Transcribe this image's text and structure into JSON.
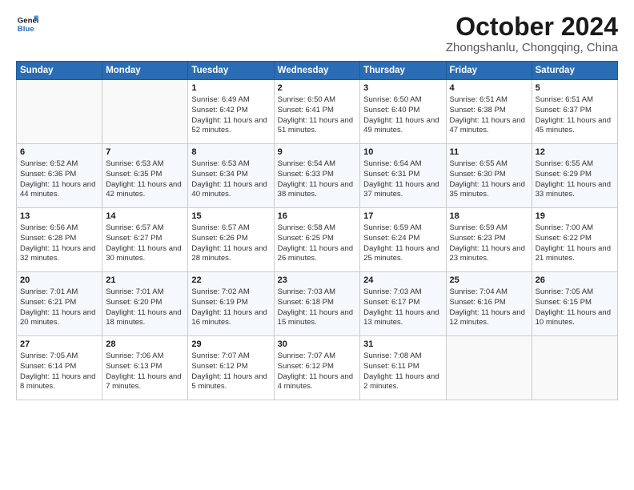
{
  "logo": {
    "line1": "General",
    "line2": "Blue"
  },
  "title": "October 2024",
  "location": "Zhongshanlu, Chongqing, China",
  "headers": [
    "Sunday",
    "Monday",
    "Tuesday",
    "Wednesday",
    "Thursday",
    "Friday",
    "Saturday"
  ],
  "weeks": [
    [
      {
        "day": "",
        "info": ""
      },
      {
        "day": "",
        "info": ""
      },
      {
        "day": "1",
        "info": "Sunrise: 6:49 AM\nSunset: 6:42 PM\nDaylight: 11 hours and 52 minutes."
      },
      {
        "day": "2",
        "info": "Sunrise: 6:50 AM\nSunset: 6:41 PM\nDaylight: 11 hours and 51 minutes."
      },
      {
        "day": "3",
        "info": "Sunrise: 6:50 AM\nSunset: 6:40 PM\nDaylight: 11 hours and 49 minutes."
      },
      {
        "day": "4",
        "info": "Sunrise: 6:51 AM\nSunset: 6:38 PM\nDaylight: 11 hours and 47 minutes."
      },
      {
        "day": "5",
        "info": "Sunrise: 6:51 AM\nSunset: 6:37 PM\nDaylight: 11 hours and 45 minutes."
      }
    ],
    [
      {
        "day": "6",
        "info": "Sunrise: 6:52 AM\nSunset: 6:36 PM\nDaylight: 11 hours and 44 minutes."
      },
      {
        "day": "7",
        "info": "Sunrise: 6:53 AM\nSunset: 6:35 PM\nDaylight: 11 hours and 42 minutes."
      },
      {
        "day": "8",
        "info": "Sunrise: 6:53 AM\nSunset: 6:34 PM\nDaylight: 11 hours and 40 minutes."
      },
      {
        "day": "9",
        "info": "Sunrise: 6:54 AM\nSunset: 6:33 PM\nDaylight: 11 hours and 38 minutes."
      },
      {
        "day": "10",
        "info": "Sunrise: 6:54 AM\nSunset: 6:31 PM\nDaylight: 11 hours and 37 minutes."
      },
      {
        "day": "11",
        "info": "Sunrise: 6:55 AM\nSunset: 6:30 PM\nDaylight: 11 hours and 35 minutes."
      },
      {
        "day": "12",
        "info": "Sunrise: 6:55 AM\nSunset: 6:29 PM\nDaylight: 11 hours and 33 minutes."
      }
    ],
    [
      {
        "day": "13",
        "info": "Sunrise: 6:56 AM\nSunset: 6:28 PM\nDaylight: 11 hours and 32 minutes."
      },
      {
        "day": "14",
        "info": "Sunrise: 6:57 AM\nSunset: 6:27 PM\nDaylight: 11 hours and 30 minutes."
      },
      {
        "day": "15",
        "info": "Sunrise: 6:57 AM\nSunset: 6:26 PM\nDaylight: 11 hours and 28 minutes."
      },
      {
        "day": "16",
        "info": "Sunrise: 6:58 AM\nSunset: 6:25 PM\nDaylight: 11 hours and 26 minutes."
      },
      {
        "day": "17",
        "info": "Sunrise: 6:59 AM\nSunset: 6:24 PM\nDaylight: 11 hours and 25 minutes."
      },
      {
        "day": "18",
        "info": "Sunrise: 6:59 AM\nSunset: 6:23 PM\nDaylight: 11 hours and 23 minutes."
      },
      {
        "day": "19",
        "info": "Sunrise: 7:00 AM\nSunset: 6:22 PM\nDaylight: 11 hours and 21 minutes."
      }
    ],
    [
      {
        "day": "20",
        "info": "Sunrise: 7:01 AM\nSunset: 6:21 PM\nDaylight: 11 hours and 20 minutes."
      },
      {
        "day": "21",
        "info": "Sunrise: 7:01 AM\nSunset: 6:20 PM\nDaylight: 11 hours and 18 minutes."
      },
      {
        "day": "22",
        "info": "Sunrise: 7:02 AM\nSunset: 6:19 PM\nDaylight: 11 hours and 16 minutes."
      },
      {
        "day": "23",
        "info": "Sunrise: 7:03 AM\nSunset: 6:18 PM\nDaylight: 11 hours and 15 minutes."
      },
      {
        "day": "24",
        "info": "Sunrise: 7:03 AM\nSunset: 6:17 PM\nDaylight: 11 hours and 13 minutes."
      },
      {
        "day": "25",
        "info": "Sunrise: 7:04 AM\nSunset: 6:16 PM\nDaylight: 11 hours and 12 minutes."
      },
      {
        "day": "26",
        "info": "Sunrise: 7:05 AM\nSunset: 6:15 PM\nDaylight: 11 hours and 10 minutes."
      }
    ],
    [
      {
        "day": "27",
        "info": "Sunrise: 7:05 AM\nSunset: 6:14 PM\nDaylight: 11 hours and 8 minutes."
      },
      {
        "day": "28",
        "info": "Sunrise: 7:06 AM\nSunset: 6:13 PM\nDaylight: 11 hours and 7 minutes."
      },
      {
        "day": "29",
        "info": "Sunrise: 7:07 AM\nSunset: 6:12 PM\nDaylight: 11 hours and 5 minutes."
      },
      {
        "day": "30",
        "info": "Sunrise: 7:07 AM\nSunset: 6:12 PM\nDaylight: 11 hours and 4 minutes."
      },
      {
        "day": "31",
        "info": "Sunrise: 7:08 AM\nSunset: 6:11 PM\nDaylight: 11 hours and 2 minutes."
      },
      {
        "day": "",
        "info": ""
      },
      {
        "day": "",
        "info": ""
      }
    ]
  ]
}
